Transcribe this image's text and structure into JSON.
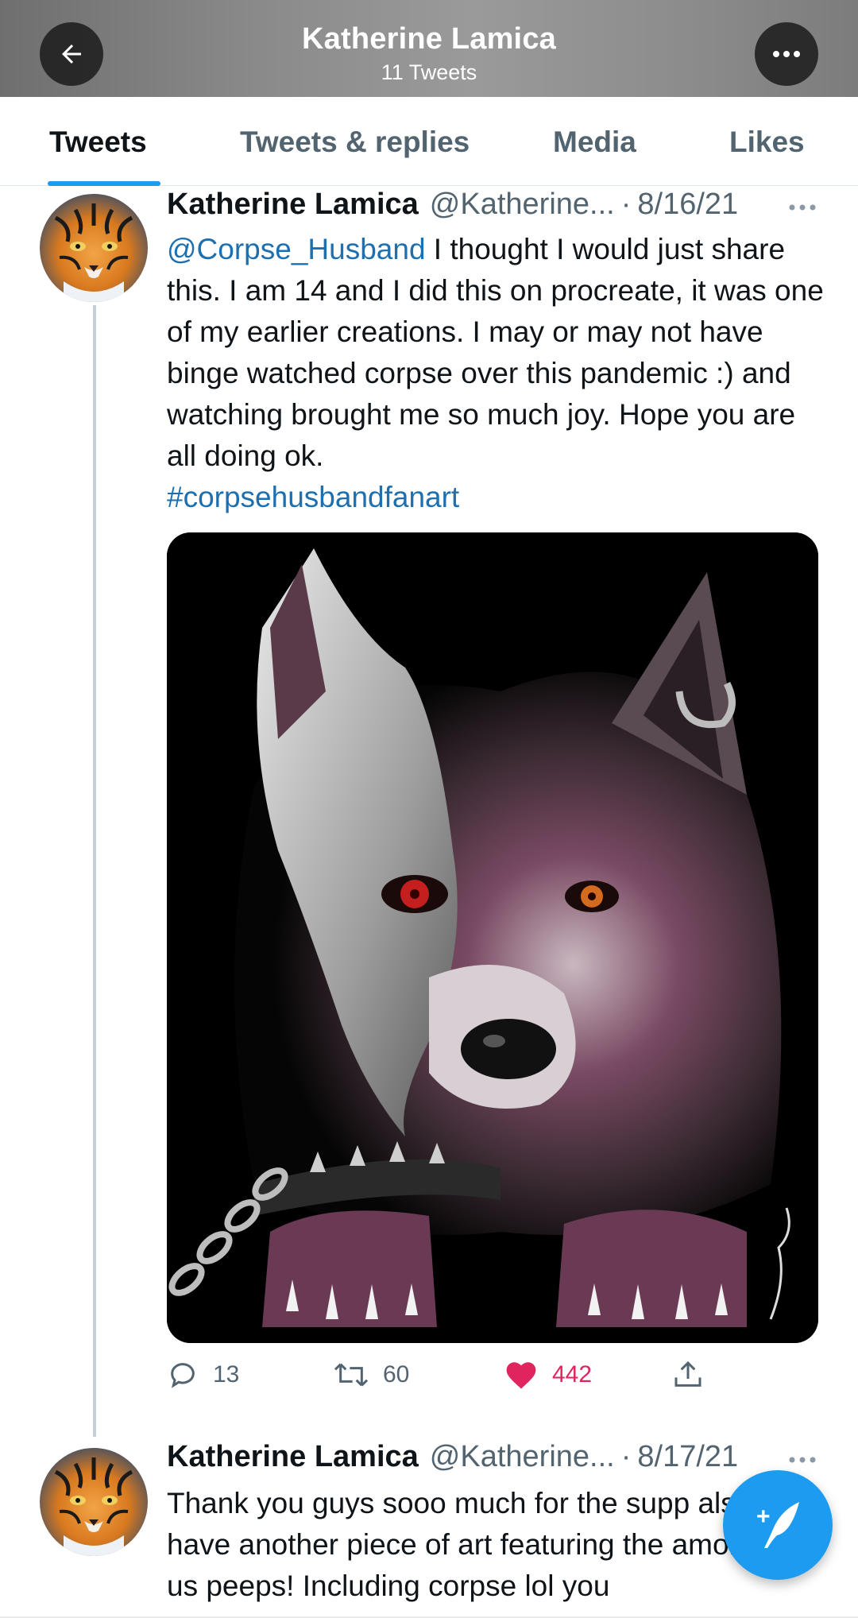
{
  "header": {
    "title": "Katherine Lamica",
    "subtitle": "11 Tweets",
    "back_icon": "arrow-left-icon",
    "more_icon": "ellipsis-icon"
  },
  "tabs": [
    {
      "label": "Tweets",
      "active": true
    },
    {
      "label": "Tweets & replies",
      "active": false
    },
    {
      "label": "Media",
      "active": false
    },
    {
      "label": "Likes",
      "active": false
    }
  ],
  "tweets": [
    {
      "name": "Katherine Lamica",
      "handle": "@Katherine...",
      "separator": "·",
      "date": "8/16/21",
      "mention": "@Corpse_Husband",
      "text": " I thought I would just share this. I am 14 and I did this on procreate, it was one of my earlier creations. I may or may not have binge watched corpse over this pandemic :) and watching brought me so much joy. Hope you are all doing ok.",
      "hashtag": "#corpsehusbandfanart",
      "media": "wolf-artwork-image",
      "replies": "13",
      "retweets": "60",
      "likes": "442"
    },
    {
      "name": "Katherine Lamica",
      "handle": "@Katherine...",
      "separator": "·",
      "date": "8/17/21",
      "text": "Thank you guys sooo much for the supp also have another piece of art featuring the among us peeps! Including corpse lol you"
    }
  ],
  "fab": {
    "icon": "compose-tweet-icon",
    "plus": "+"
  },
  "colors": {
    "accent": "#1d9bf0",
    "like": "#e0245e",
    "link": "#1d6fb0"
  }
}
